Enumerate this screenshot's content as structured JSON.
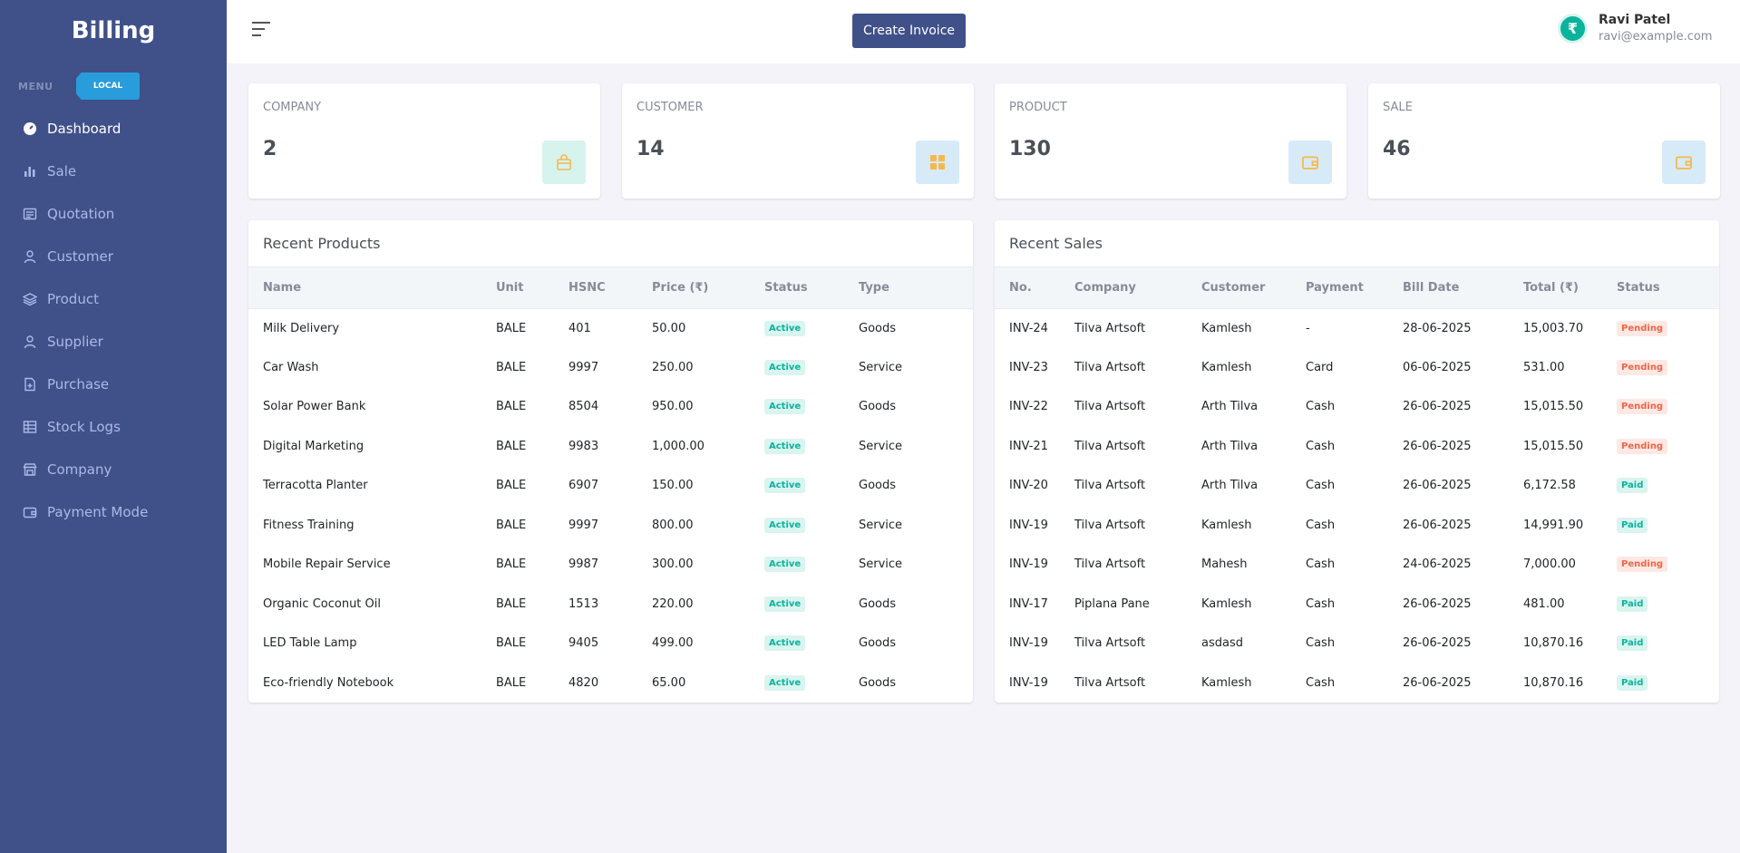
{
  "brand": "Billing",
  "menu_title": "MENU",
  "env_badge": "LOCAL",
  "nav": [
    {
      "label": "Dashboard",
      "icon": "dashboard-icon",
      "active": true
    },
    {
      "label": "Sale",
      "icon": "bar-chart-icon"
    },
    {
      "label": "Quotation",
      "icon": "newspaper-icon"
    },
    {
      "label": "Customer",
      "icon": "user-icon"
    },
    {
      "label": "Product",
      "icon": "layers-icon"
    },
    {
      "label": "Supplier",
      "icon": "user-icon"
    },
    {
      "label": "Purchase",
      "icon": "file-icon"
    },
    {
      "label": "Stock Logs",
      "icon": "table-icon"
    },
    {
      "label": "Company",
      "icon": "store-icon"
    },
    {
      "label": "Payment Mode",
      "icon": "wallet-icon"
    }
  ],
  "topbar": {
    "create_label": "Create Invoice",
    "user_name": "Ravi Patel",
    "user_email": "ravi@example.com",
    "avatar_glyph": "₹"
  },
  "stats": [
    {
      "label": "COMPANY",
      "value": "2",
      "icon": "bag-icon",
      "bg": "#d6f3ee",
      "fg": "#f7b84b"
    },
    {
      "label": "CUSTOMER",
      "value": "14",
      "icon": "grid-icon",
      "bg": "#d7eaf7",
      "fg": "#f7b84b"
    },
    {
      "label": "PRODUCT",
      "value": "130",
      "icon": "wallet-icon",
      "bg": "#d7eaf7",
      "fg": "#f7b84b"
    },
    {
      "label": "SALE",
      "value": "46",
      "icon": "wallet-icon",
      "bg": "#d7eaf7",
      "fg": "#f7b84b"
    }
  ],
  "products": {
    "title": "Recent Products",
    "headers": [
      "Name",
      "Unit",
      "HSNC",
      "Price (₹)",
      "Status",
      "Type"
    ],
    "rows": [
      [
        "Milk Delivery",
        "BALE",
        "401",
        "50.00",
        "Active",
        "Goods"
      ],
      [
        "Car Wash",
        "BALE",
        "9997",
        "250.00",
        "Active",
        "Service"
      ],
      [
        "Solar Power Bank",
        "BALE",
        "8504",
        "950.00",
        "Active",
        "Goods"
      ],
      [
        "Digital Marketing",
        "BALE",
        "9983",
        "1,000.00",
        "Active",
        "Service"
      ],
      [
        "Terracotta Planter",
        "BALE",
        "6907",
        "150.00",
        "Active",
        "Goods"
      ],
      [
        "Fitness Training",
        "BALE",
        "9997",
        "800.00",
        "Active",
        "Service"
      ],
      [
        "Mobile Repair Service",
        "BALE",
        "9987",
        "300.00",
        "Active",
        "Service"
      ],
      [
        "Organic Coconut Oil",
        "BALE",
        "1513",
        "220.00",
        "Active",
        "Goods"
      ],
      [
        "LED Table Lamp",
        "BALE",
        "9405",
        "499.00",
        "Active",
        "Goods"
      ],
      [
        "Eco-friendly Notebook",
        "BALE",
        "4820",
        "65.00",
        "Active",
        "Goods"
      ]
    ]
  },
  "sales": {
    "title": "Recent Sales",
    "headers": [
      "No.",
      "Company",
      "Customer",
      "Payment",
      "Bill Date",
      "Total (₹)",
      "Status"
    ],
    "rows": [
      [
        "INV-24",
        "Tilva Artsoft",
        "Kamlesh",
        "-",
        "28-06-2025",
        "15,003.70",
        "Pending"
      ],
      [
        "INV-23",
        "Tilva Artsoft",
        "Kamlesh",
        "Card",
        "06-06-2025",
        "531.00",
        "Pending"
      ],
      [
        "INV-22",
        "Tilva Artsoft",
        "Arth Tilva",
        "Cash",
        "26-06-2025",
        "15,015.50",
        "Pending"
      ],
      [
        "INV-21",
        "Tilva Artsoft",
        "Arth Tilva",
        "Cash",
        "26-06-2025",
        "15,015.50",
        "Pending"
      ],
      [
        "INV-20",
        "Tilva Artsoft",
        "Arth Tilva",
        "Cash",
        "26-06-2025",
        "6,172.58",
        "Paid"
      ],
      [
        "INV-19",
        "Tilva Artsoft",
        "Kamlesh",
        "Cash",
        "26-06-2025",
        "14,991.90",
        "Paid"
      ],
      [
        "INV-19",
        "Tilva Artsoft",
        "Mahesh",
        "Cash",
        "24-06-2025",
        "7,000.00",
        "Pending"
      ],
      [
        "INV-17",
        "Piplana Pane",
        "Kamlesh",
        "Cash",
        "26-06-2025",
        "481.00",
        "Paid"
      ],
      [
        "INV-19",
        "Tilva Artsoft",
        "asdasd",
        "Cash",
        "26-06-2025",
        "10,870.16",
        "Paid"
      ],
      [
        "INV-19",
        "Tilva Artsoft",
        "Kamlesh",
        "Cash",
        "26-06-2025",
        "10,870.16",
        "Paid"
      ]
    ]
  }
}
